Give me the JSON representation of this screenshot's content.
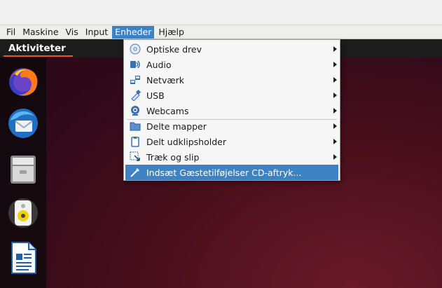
{
  "menubar": {
    "items": [
      "Fil",
      "Maskine",
      "Vis",
      "Input",
      "Enheder",
      "Hjælp"
    ],
    "active": "Enheder"
  },
  "guest": {
    "activities_label": "Aktiviteter",
    "dock": [
      "firefox-icon",
      "thunderbird-icon",
      "files-icon",
      "rhythmbox-icon",
      "libreoffice-writer-icon"
    ]
  },
  "devices_menu": {
    "items": [
      {
        "label": "Optiske drev",
        "icon": "optical-disc-icon",
        "submenu": true
      },
      {
        "label": "Audio",
        "icon": "audio-icon",
        "submenu": true
      },
      {
        "label": "Netværk",
        "icon": "network-icon",
        "submenu": true
      },
      {
        "label": "USB",
        "icon": "usb-icon",
        "submenu": true
      },
      {
        "label": "Webcams",
        "icon": "webcam-icon",
        "submenu": true
      },
      {
        "label": "Delte mapper",
        "icon": "shared-folder-icon",
        "submenu": true
      },
      {
        "label": "Delt udklipsholder",
        "icon": "clipboard-icon",
        "submenu": true
      },
      {
        "label": "Træk og slip",
        "icon": "drag-drop-icon",
        "submenu": true
      },
      {
        "label": "Indsæt Gæstetilføjelser CD-aftryk...",
        "icon": "insert-cd-icon",
        "submenu": false,
        "highlighted": true
      }
    ]
  },
  "colors": {
    "accent": "#3d83c3",
    "ubuntu_orange": "#e95420"
  }
}
